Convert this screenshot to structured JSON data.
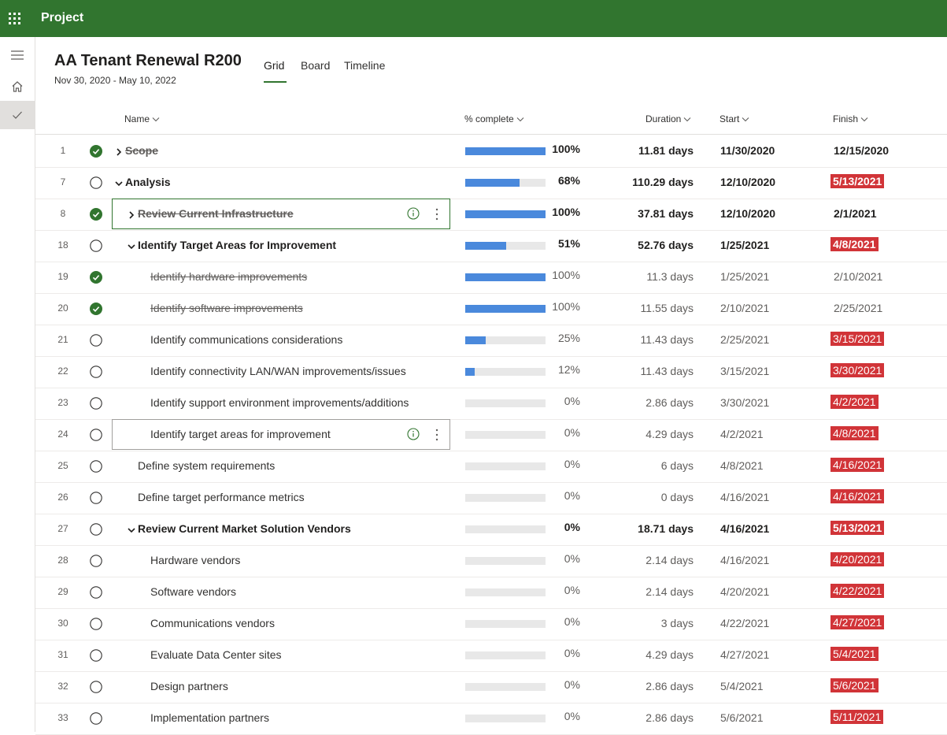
{
  "app": {
    "title": "Project",
    "accent": "#31752f"
  },
  "project": {
    "title": "AA Tenant Renewal R200",
    "dates": "Nov 30, 2020 - May 10, 2022"
  },
  "tabs": [
    {
      "label": "Grid",
      "active": true
    },
    {
      "label": "Board",
      "active": false
    },
    {
      "label": "Timeline",
      "active": false
    }
  ],
  "columns": {
    "name": "Name",
    "pct": "% complete",
    "duration": "Duration",
    "start": "Start",
    "finish": "Finish"
  },
  "rows": [
    {
      "num": "1",
      "name": "Scope",
      "pct": 100,
      "pct_label": "100%",
      "duration": "11.81 days",
      "start": "11/30/2020",
      "finish": "12/15/2020",
      "done": true,
      "bold": true,
      "late": false,
      "indent": 0,
      "chevron": "right"
    },
    {
      "num": "7",
      "name": "Analysis",
      "pct": 68,
      "pct_label": "68%",
      "duration": "110.29 days",
      "start": "12/10/2020",
      "finish": "5/13/2021",
      "done": false,
      "bold": true,
      "late": true,
      "indent": 0,
      "chevron": "down"
    },
    {
      "num": "8",
      "name": "Review Current Infrastructure",
      "pct": 100,
      "pct_label": "100%",
      "duration": "37.81 days",
      "start": "12/10/2020",
      "finish": "2/1/2021",
      "done": true,
      "bold": true,
      "late": false,
      "indent": 1,
      "chevron": "right",
      "selected": "green"
    },
    {
      "num": "18",
      "name": "Identify Target Areas for Improvement",
      "pct": 51,
      "pct_label": "51%",
      "duration": "52.76 days",
      "start": "1/25/2021",
      "finish": "4/8/2021",
      "done": false,
      "bold": true,
      "late": true,
      "indent": 1,
      "chevron": "down"
    },
    {
      "num": "19",
      "name": "Identify hardware improvements",
      "pct": 100,
      "pct_label": "100%",
      "duration": "11.3 days",
      "start": "1/25/2021",
      "finish": "2/10/2021",
      "done": true,
      "bold": false,
      "late": false,
      "indent": 2
    },
    {
      "num": "20",
      "name": "Identify software improvements",
      "pct": 100,
      "pct_label": "100%",
      "duration": "11.55 days",
      "start": "2/10/2021",
      "finish": "2/25/2021",
      "done": true,
      "bold": false,
      "late": false,
      "indent": 2
    },
    {
      "num": "21",
      "name": "Identify communications considerations",
      "pct": 25,
      "pct_label": "25%",
      "duration": "11.43 days",
      "start": "2/25/2021",
      "finish": "3/15/2021",
      "done": false,
      "bold": false,
      "late": true,
      "indent": 2
    },
    {
      "num": "22",
      "name": "Identify connectivity LAN/WAN improvements/issues",
      "pct": 12,
      "pct_label": "12%",
      "duration": "11.43 days",
      "start": "3/15/2021",
      "finish": "3/30/2021",
      "done": false,
      "bold": false,
      "late": true,
      "indent": 2
    },
    {
      "num": "23",
      "name": "Identify support environment improvements/additions",
      "pct": 0,
      "pct_label": "0%",
      "duration": "2.86 days",
      "start": "3/30/2021",
      "finish": "4/2/2021",
      "done": false,
      "bold": false,
      "late": true,
      "indent": 2
    },
    {
      "num": "24",
      "name": "Identify target areas for improvement",
      "pct": 0,
      "pct_label": "0%",
      "duration": "4.29 days",
      "start": "4/2/2021",
      "finish": "4/8/2021",
      "done": false,
      "bold": false,
      "late": true,
      "indent": 2,
      "selected": "grey"
    },
    {
      "num": "25",
      "name": "Define system requirements",
      "pct": 0,
      "pct_label": "0%",
      "duration": "6 days",
      "start": "4/8/2021",
      "finish": "4/16/2021",
      "done": false,
      "bold": false,
      "late": true,
      "indent": 1
    },
    {
      "num": "26",
      "name": "Define target performance metrics",
      "pct": 0,
      "pct_label": "0%",
      "duration": "0 days",
      "start": "4/16/2021",
      "finish": "4/16/2021",
      "done": false,
      "bold": false,
      "late": true,
      "indent": 1
    },
    {
      "num": "27",
      "name": "Review Current Market Solution Vendors",
      "pct": 0,
      "pct_label": "0%",
      "duration": "18.71 days",
      "start": "4/16/2021",
      "finish": "5/13/2021",
      "done": false,
      "bold": true,
      "late": true,
      "indent": 1,
      "chevron": "down"
    },
    {
      "num": "28",
      "name": "Hardware vendors",
      "pct": 0,
      "pct_label": "0%",
      "duration": "2.14 days",
      "start": "4/16/2021",
      "finish": "4/20/2021",
      "done": false,
      "bold": false,
      "late": true,
      "indent": 2
    },
    {
      "num": "29",
      "name": "Software vendors",
      "pct": 0,
      "pct_label": "0%",
      "duration": "2.14 days",
      "start": "4/20/2021",
      "finish": "4/22/2021",
      "done": false,
      "bold": false,
      "late": true,
      "indent": 2
    },
    {
      "num": "30",
      "name": "Communications vendors",
      "pct": 0,
      "pct_label": "0%",
      "duration": "3 days",
      "start": "4/22/2021",
      "finish": "4/27/2021",
      "done": false,
      "bold": false,
      "late": true,
      "indent": 2
    },
    {
      "num": "31",
      "name": "Evaluate Data Center sites",
      "pct": 0,
      "pct_label": "0%",
      "duration": "4.29 days",
      "start": "4/27/2021",
      "finish": "5/4/2021",
      "done": false,
      "bold": false,
      "late": true,
      "indent": 2
    },
    {
      "num": "32",
      "name": "Design partners",
      "pct": 0,
      "pct_label": "0%",
      "duration": "2.86 days",
      "start": "5/4/2021",
      "finish": "5/6/2021",
      "done": false,
      "bold": false,
      "late": true,
      "indent": 2
    },
    {
      "num": "33",
      "name": "Implementation partners",
      "pct": 0,
      "pct_label": "0%",
      "duration": "2.86 days",
      "start": "5/6/2021",
      "finish": "5/11/2021",
      "done": false,
      "bold": false,
      "late": true,
      "indent": 2
    }
  ],
  "colors": {
    "complete_check": "#31752f",
    "progress": "#4a89dc",
    "late": "#d13438"
  },
  "icons": {
    "app_launcher": "waffle-icon",
    "menu": "hamburger-icon",
    "home": "home-icon",
    "tasks": "checkmark-icon",
    "info": "info-icon",
    "more": "more-vertical-icon"
  }
}
